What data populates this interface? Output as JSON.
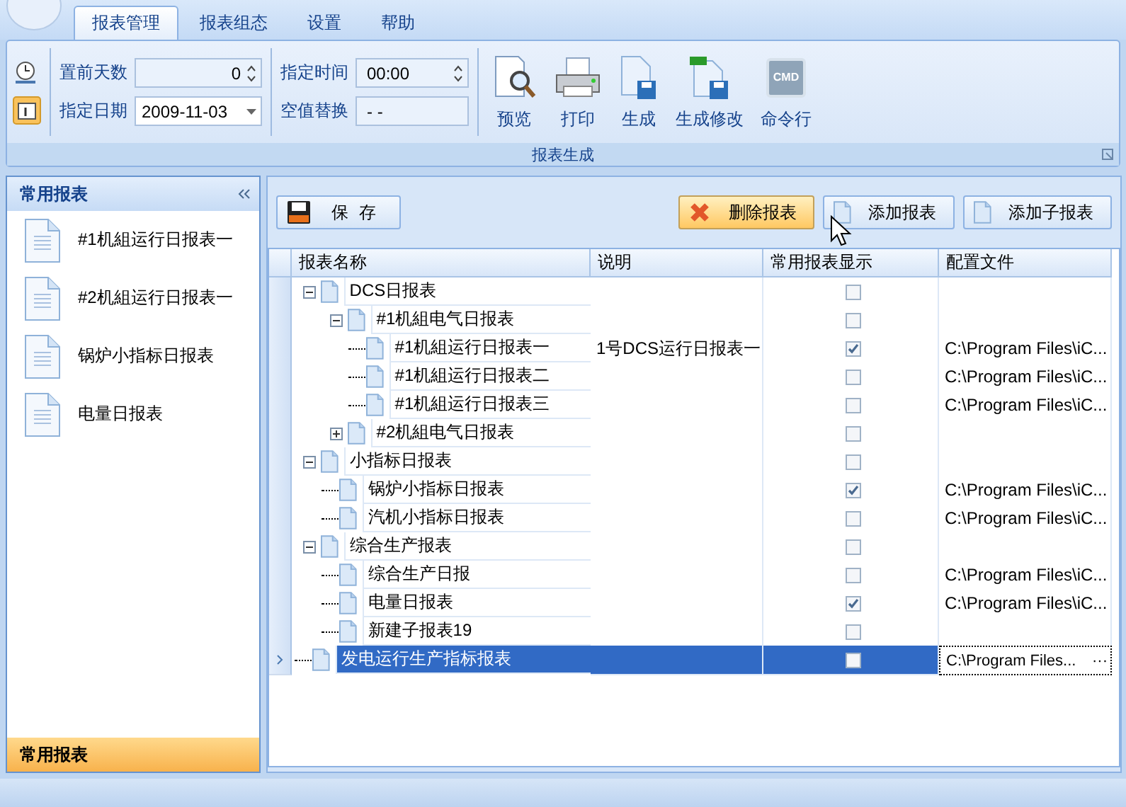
{
  "ribbon": {
    "tabs": [
      {
        "label": "报表管理",
        "selected": true
      },
      {
        "label": "报表组态",
        "selected": false
      },
      {
        "label": "设置",
        "selected": false
      },
      {
        "label": "帮助",
        "selected": false
      }
    ],
    "fields": [
      {
        "label": "置前天数",
        "value": "0",
        "kind": "spin"
      },
      {
        "label": "指定日期",
        "value": "2009-11-03",
        "kind": "dropdown"
      },
      {
        "label": "指定时间",
        "value": "00:00",
        "kind": "spin"
      },
      {
        "label": "空值替换",
        "value": "- -",
        "kind": "text"
      }
    ],
    "buttons": [
      {
        "label": "预览",
        "kind": "preview"
      },
      {
        "label": "打印",
        "kind": "print"
      },
      {
        "label": "生成",
        "kind": "save"
      },
      {
        "label": "生成修改",
        "kind": "xls"
      },
      {
        "label": "命令行",
        "kind": "cmd",
        "badge": "CMD"
      }
    ],
    "group_label": "报表生成"
  },
  "sidebar": {
    "title": "常用报表",
    "items": [
      "#1机組运行日报表一",
      "#2机組运行日报表一",
      "锅炉小指标日报表",
      "电量日报表"
    ],
    "footer_tab": "常用报表"
  },
  "toolbar": {
    "save": "保  存",
    "buttons": [
      {
        "label": "删除报表",
        "kind": "delete",
        "hovered": true
      },
      {
        "label": "添加报表",
        "kind": "add",
        "hovered": false
      },
      {
        "label": "添加子报表",
        "kind": "add",
        "hovered": false
      }
    ]
  },
  "grid": {
    "columns": [
      "报表名称",
      "说明",
      "常用报表显示",
      "配置文件"
    ],
    "rows": [
      {
        "name": "DCS日报表",
        "checked": false,
        "expanded": true,
        "selected": false,
        "children": [
          {
            "name": "#1机組电气日报表",
            "checked": false,
            "expanded": true,
            "selected": false,
            "children": [
              {
                "name": "#1机組运行日报表一",
                "note": "1号DCS运行日报表一",
                "checked": true,
                "config": "C:\\Program Files\\iC...",
                "selected": false
              },
              {
                "name": "#1机組运行日报表二",
                "checked": false,
                "config": "C:\\Program Files\\iC...",
                "selected": false
              },
              {
                "name": "#1机組运行日报表三",
                "checked": false,
                "config": "C:\\Program Files\\iC...",
                "selected": false
              }
            ]
          },
          {
            "name": "#2机組电气日报表",
            "checked": false,
            "expanded": false,
            "selected": false
          }
        ]
      },
      {
        "name": "小指标日报表",
        "checked": false,
        "expanded": true,
        "selected": false,
        "children": [
          {
            "name": "锅炉小指标日报表",
            "checked": true,
            "config": "C:\\Program Files\\iC...",
            "selected": false
          },
          {
            "name": "汽机小指标日报表",
            "checked": false,
            "config": "C:\\Program Files\\iC...",
            "selected": false
          }
        ]
      },
      {
        "name": "综合生产报表",
        "checked": false,
        "expanded": true,
        "selected": false,
        "children": [
          {
            "name": "综合生产日报",
            "checked": false,
            "config": "C:\\Program Files\\iC...",
            "selected": false
          },
          {
            "name": "电量日报表",
            "checked": true,
            "config": "C:\\Program Files\\iC...",
            "selected": false
          },
          {
            "name": "新建子报表19",
            "checked": false,
            "selected": false
          }
        ]
      },
      {
        "name": "发电运行生产指标报表",
        "checked": false,
        "config": "C:\\Program Files...",
        "selected": true,
        "ellipsis": "···"
      }
    ]
  }
}
